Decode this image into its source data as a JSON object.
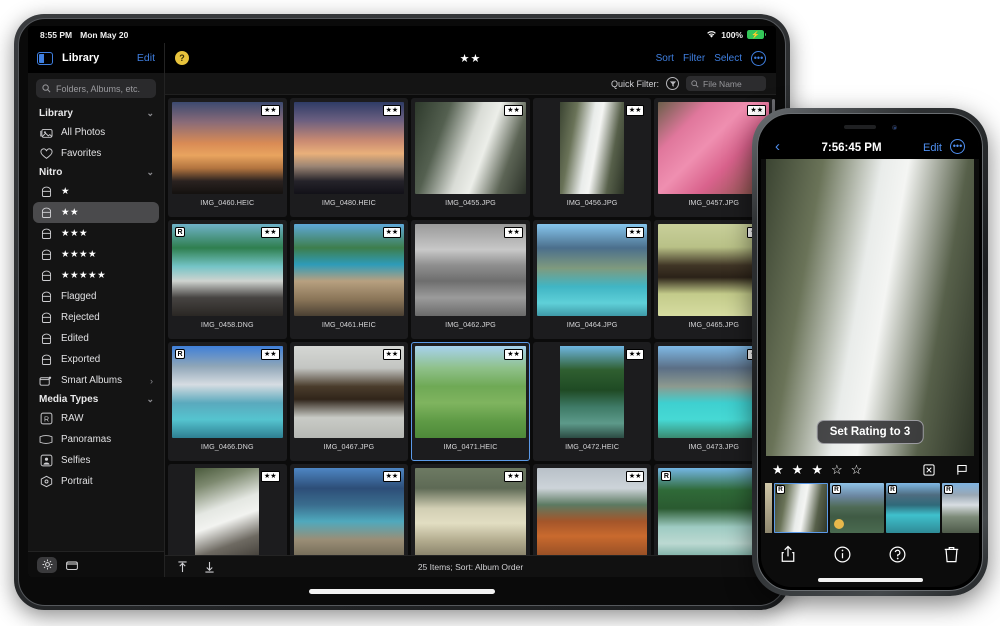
{
  "ipad": {
    "statusbar": {
      "time": "8:55 PM",
      "date": "Mon May 20",
      "wifi_icon": "wifi-icon",
      "battery_percent": "100%",
      "battery_icon": "battery-charging-icon"
    },
    "sidebar": {
      "toggle_icon": "sidebar-toggle-icon",
      "title": "Library",
      "edit_label": "Edit",
      "search_placeholder": "Folders, Albums, etc.",
      "search_icon": "search-icon",
      "groups": [
        {
          "label": "Library",
          "chevron": "chevron-down-icon",
          "items": [
            {
              "label": "All Photos",
              "icon": "photos-stack-icon"
            },
            {
              "label": "Favorites",
              "icon": "heart-icon"
            }
          ]
        },
        {
          "label": "Nitro",
          "chevron": "chevron-down-icon",
          "items": [
            {
              "label": "★",
              "icon": "album-icon"
            },
            {
              "label": "★★",
              "icon": "album-icon",
              "selected": true
            },
            {
              "label": "★★★",
              "icon": "album-icon"
            },
            {
              "label": "★★★★",
              "icon": "album-icon"
            },
            {
              "label": "★★★★★",
              "icon": "album-icon"
            },
            {
              "label": "Flagged",
              "icon": "album-icon"
            },
            {
              "label": "Rejected",
              "icon": "album-icon"
            },
            {
              "label": "Edited",
              "icon": "album-icon"
            },
            {
              "label": "Exported",
              "icon": "album-icon"
            },
            {
              "label": "Smart Albums",
              "icon": "smart-album-icon",
              "chevron": "chevron-right-icon"
            }
          ]
        },
        {
          "label": "Media Types",
          "chevron": "chevron-down-icon",
          "items": [
            {
              "label": "RAW",
              "icon": "raw-icon"
            },
            {
              "label": "Panoramas",
              "icon": "panorama-icon"
            },
            {
              "label": "Selfies",
              "icon": "selfie-icon"
            },
            {
              "label": "Portrait",
              "icon": "portrait-icon"
            }
          ]
        }
      ],
      "bottom_buttons": [
        {
          "icon": "settings-gear-icon",
          "active": true
        },
        {
          "icon": "folder-icon",
          "active": false
        }
      ]
    },
    "main": {
      "help_badge": "?",
      "help_icon": "help-icon",
      "title": "★★",
      "actions": [
        {
          "label": "Sort",
          "name": "sort-button"
        },
        {
          "label": "Filter",
          "name": "filter-button"
        },
        {
          "label": "Select",
          "name": "select-button"
        }
      ],
      "more_icon": "more-ellipsis-icon",
      "filterbar": {
        "label": "Quick Filter:",
        "filter_icon": "quick-filter-icon",
        "search_icon": "search-icon",
        "search_placeholder": "File Name"
      },
      "footer": {
        "import_icon": "import-arrow-up-icon",
        "export_icon": "export-arrow-down-icon",
        "status": "25 Items; Sort: Album Order"
      },
      "grid": [
        {
          "name": "IMG_0460.HEIC",
          "rating": "★★",
          "raw": false,
          "art": "sunset-palms",
          "orient": "land"
        },
        {
          "name": "IMG_0480.HEIC",
          "rating": "★★",
          "raw": false,
          "art": "sunset-ocean",
          "orient": "land"
        },
        {
          "name": "IMG_0455.JPG",
          "rating": "★★",
          "raw": false,
          "art": "waterfall-misty",
          "orient": "land"
        },
        {
          "name": "IMG_0456.JPG",
          "rating": "★★",
          "raw": false,
          "art": "waterfall-tall",
          "orient": "port"
        },
        {
          "name": "IMG_0457.JPG",
          "rating": "★★",
          "raw": false,
          "art": "pink-flowers",
          "orient": "land"
        },
        {
          "name": "IMG_0458.DNG",
          "rating": "★★",
          "raw": true,
          "art": "beach-cove",
          "orient": "land"
        },
        {
          "name": "IMG_0461.HEIC",
          "rating": "★★",
          "raw": false,
          "art": "driftwood-tree",
          "orient": "land"
        },
        {
          "name": "IMG_0462.JPG",
          "rating": "★★",
          "raw": false,
          "art": "bw-beach-dog",
          "orient": "land"
        },
        {
          "name": "IMG_0464.JPG",
          "rating": "★★",
          "raw": false,
          "art": "lake-mountain-teal",
          "orient": "land"
        },
        {
          "name": "IMG_0465.JPG",
          "rating": "★★",
          "raw": false,
          "art": "bison-grass",
          "orient": "land"
        },
        {
          "name": "IMG_0466.DNG",
          "rating": "★★",
          "raw": true,
          "art": "lake-louise",
          "orient": "land"
        },
        {
          "name": "IMG_0467.JPG",
          "rating": "★★",
          "raw": false,
          "art": "bison-snow",
          "orient": "land"
        },
        {
          "name": "IMG_0471.HEIC",
          "rating": "★★",
          "raw": false,
          "art": "cattle-field",
          "orient": "land",
          "selected": true
        },
        {
          "name": "IMG_0472.HEIC",
          "rating": "★★",
          "raw": false,
          "art": "palms-river",
          "orient": "port"
        },
        {
          "name": "IMG_0473.JPG",
          "rating": "★★",
          "raw": false,
          "art": "peyto-lake",
          "orient": "land"
        },
        {
          "name": "",
          "rating": "★★",
          "raw": false,
          "art": "river-rocks",
          "orient": "port"
        },
        {
          "name": "",
          "rating": "★★",
          "raw": false,
          "art": "moraine-lake",
          "orient": "land"
        },
        {
          "name": "",
          "rating": "★★",
          "raw": false,
          "art": "canyon-cliffs",
          "orient": "land"
        },
        {
          "name": "",
          "rating": "★★",
          "raw": false,
          "art": "geyser-basin",
          "orient": "land"
        },
        {
          "name": "",
          "rating": "",
          "raw": true,
          "art": "tropic-lagoon",
          "orient": "land"
        }
      ]
    }
  },
  "iphone": {
    "back_icon": "chevron-left-icon",
    "time": "7:56:45 PM",
    "edit_label": "Edit",
    "more_icon": "more-ellipsis-icon",
    "photo_art": "waterfall-tall",
    "tooltip": "Set Rating to 3",
    "rating": {
      "value": 3,
      "max": 5,
      "filled_icon": "star-filled-icon",
      "empty_icon": "star-outline-icon"
    },
    "rating_actions": [
      {
        "icon": "reject-x-icon",
        "name": "reject-button"
      },
      {
        "icon": "flag-icon",
        "name": "flag-button"
      }
    ],
    "filmstrip": [
      {
        "art": "waterfall-tall",
        "raw": true,
        "selected": true,
        "dot": false
      },
      {
        "art": "mountain-vista",
        "raw": true,
        "selected": false,
        "dot": true
      },
      {
        "art": "teal-lake",
        "raw": true,
        "selected": false,
        "dot": false
      },
      {
        "art": "snowy-peaks",
        "raw": true,
        "selected": false,
        "dot": false
      }
    ],
    "tools": [
      {
        "icon": "share-icon",
        "name": "share-button"
      },
      {
        "icon": "info-icon",
        "name": "info-button"
      },
      {
        "icon": "help-icon",
        "name": "help-button"
      },
      {
        "icon": "trash-icon",
        "name": "delete-button"
      }
    ]
  }
}
